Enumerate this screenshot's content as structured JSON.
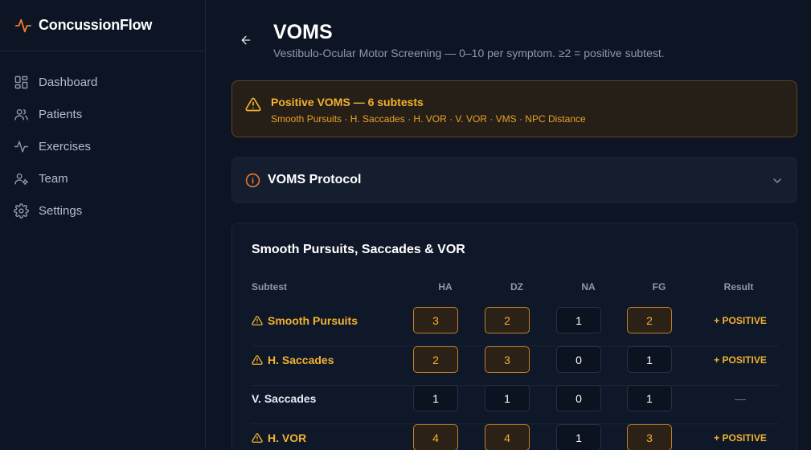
{
  "app": {
    "name": "ConcussionFlow"
  },
  "sidebar": {
    "items": [
      {
        "label": "Dashboard",
        "icon": "dashboard-icon"
      },
      {
        "label": "Patients",
        "icon": "users-icon"
      },
      {
        "label": "Exercises",
        "icon": "activity-icon"
      },
      {
        "label": "Team",
        "icon": "team-icon"
      },
      {
        "label": "Settings",
        "icon": "gear-icon"
      }
    ]
  },
  "header": {
    "title": "VOMS",
    "subtitle": "Vestibulo-Ocular Motor Screening — 0–10 per symptom. ≥2 = positive subtest."
  },
  "alert": {
    "title": "Positive VOMS — 6 subtests",
    "list": "Smooth Pursuits · H. Saccades · H. VOR · V. VOR · VMS · NPC Distance"
  },
  "protocol": {
    "title": "VOMS Protocol"
  },
  "card": {
    "title": "Smooth Pursuits, Saccades & VOR",
    "headers": {
      "subtest": "Subtest",
      "ha": "HA",
      "dz": "DZ",
      "na": "NA",
      "fg": "FG",
      "result": "Result"
    },
    "rows": [
      {
        "name": "Smooth Pursuits",
        "positive": true,
        "ha": "3",
        "dz": "2",
        "na": "1",
        "fg": "2",
        "result": "+ POSITIVE"
      },
      {
        "name": "H. Saccades",
        "positive": true,
        "ha": "2",
        "dz": "3",
        "na": "0",
        "fg": "1",
        "result": "+ POSITIVE"
      },
      {
        "name": "V. Saccades",
        "positive": false,
        "ha": "1",
        "dz": "1",
        "na": "0",
        "fg": "1",
        "result": "—"
      },
      {
        "name": "H. VOR",
        "positive": true,
        "ha": "4",
        "dz": "4",
        "na": "1",
        "fg": "3",
        "result": "+ POSITIVE"
      }
    ]
  },
  "colors": {
    "accent": "#f3b130",
    "brand": "#f07a2c",
    "background": "#0d1524"
  }
}
